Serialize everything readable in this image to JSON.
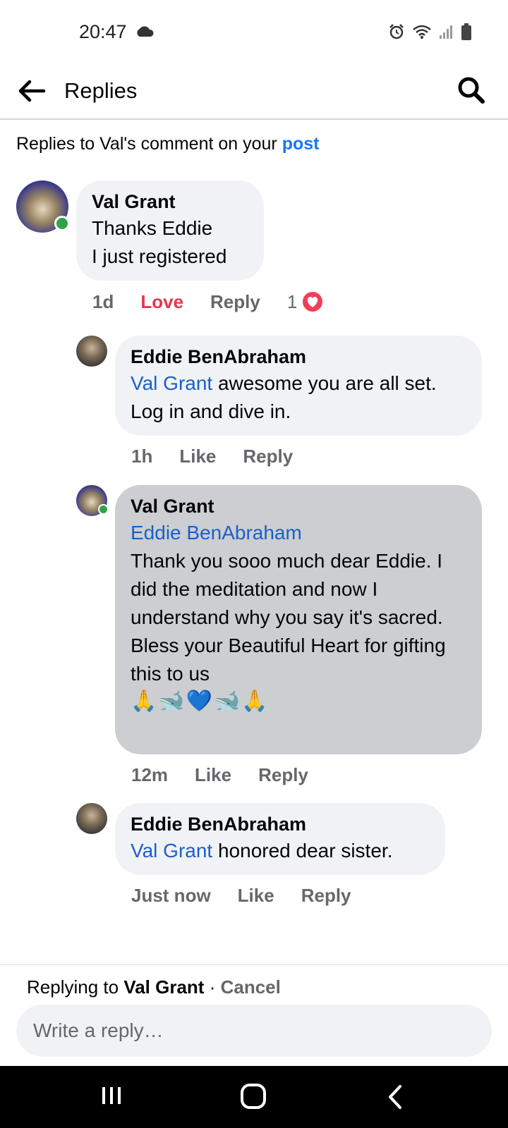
{
  "status_bar": {
    "time": "20:47",
    "icons": [
      "cloud-icon",
      "alarm-icon",
      "wifi-icon",
      "signal-icon",
      "battery-icon"
    ]
  },
  "header": {
    "title": "Replies",
    "icons": [
      "back-arrow-icon",
      "search-icon"
    ]
  },
  "subheader": {
    "prefix": "Replies to Val's comment on your ",
    "link": "post"
  },
  "comments": [
    {
      "author": "Val Grant",
      "lines": "Thanks Eddie\nI just registered",
      "time": "1d",
      "like": "Love",
      "reply": "Reply",
      "reaction_count": "1"
    },
    {
      "author": "Eddie BenAbraham",
      "mention": "Val Grant",
      "text": " awesome you are all set. Log in and dive in.",
      "time": "1h",
      "like": "Like",
      "reply": "Reply"
    },
    {
      "author": "Val Grant",
      "mention": "Eddie BenAbraham",
      "text": "Thank you sooo much dear Eddie. I did the meditation and now I understand why you say it's sacred.\nBless your Beautiful Heart for gifting this to us",
      "emojis": "🙏🐋💙🐋🙏",
      "time": "12m",
      "like": "Like",
      "reply": "Reply"
    },
    {
      "author": "Eddie BenAbraham",
      "mention": "Val Grant",
      "text": " honored dear sister.",
      "time": "Just now",
      "like": "Like",
      "reply": "Reply"
    }
  ],
  "composer": {
    "replying_prefix": "Replying to ",
    "replying_name": "Val Grant",
    "separator": " · ",
    "cancel": "Cancel",
    "placeholder": "Write a reply…"
  },
  "colors": {
    "accent": "#1877f2",
    "love": "#e2394f",
    "online": "#31a24c",
    "bubble": "#f0f2f5",
    "bubble_selected": "#ccced2"
  }
}
